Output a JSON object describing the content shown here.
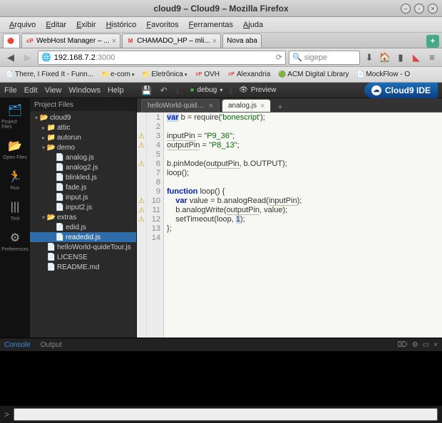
{
  "window": {
    "title": "cloud9 – Cloud9 – Mozilla Firefox"
  },
  "ff_menu": [
    "Arquivo",
    "Editar",
    "Exibir",
    "Histórico",
    "Favoritos",
    "Ferramentas",
    "Ajuda"
  ],
  "ff_tabs": [
    {
      "icon": "🔴",
      "label": "",
      "close": false
    },
    {
      "icon": "cP",
      "label": "WebHost Manager – ...",
      "close": true,
      "iconColor": "#d44"
    },
    {
      "icon": "M",
      "label": "CHAMADO_HP – mli...",
      "close": true,
      "iconColor": "#d33"
    },
    {
      "icon": "",
      "label": "Nova aba",
      "close": false
    }
  ],
  "url": {
    "host": "192.168.7.2",
    "port": ":3000"
  },
  "search": {
    "placeholder": "sigepe"
  },
  "bookmarks": [
    {
      "icon": "📄",
      "label": "There, I Fixed It - Funn..."
    },
    {
      "icon": "📁",
      "label": "e-com",
      "chev": true
    },
    {
      "icon": "📁",
      "label": "Eletrônica",
      "chev": true
    },
    {
      "icon": "cP",
      "label": "OVH",
      "iconColor": "#d44"
    },
    {
      "icon": "cP",
      "label": "Alexandria",
      "iconColor": "#d44"
    },
    {
      "icon": "🟢",
      "label": "ACM Digital Library"
    },
    {
      "icon": "📄",
      "label": "MockFlow - O"
    }
  ],
  "c9_menu": [
    "File",
    "Edit",
    "View",
    "Windows",
    "Help"
  ],
  "c9_chips": {
    "debug": "debug",
    "preview": "Preview"
  },
  "c9_logo": "Cloud9 IDE",
  "rail": [
    {
      "icon": "🗂",
      "label": "Project Files",
      "active": true
    },
    {
      "icon": "📂",
      "label": "Open Files"
    },
    {
      "icon": "🏃",
      "label": "Run"
    },
    {
      "icon": "|||",
      "label": "Test"
    },
    {
      "icon": "⚙",
      "label": "Preferences"
    }
  ],
  "tree_title": "Project Files",
  "tree": [
    {
      "d": 0,
      "t": "folder-open",
      "tw": "▾",
      "name": "cloud9"
    },
    {
      "d": 1,
      "t": "folder-closed",
      "tw": "▸",
      "name": "attic"
    },
    {
      "d": 1,
      "t": "folder-closed",
      "tw": "▸",
      "name": "autorun"
    },
    {
      "d": 1,
      "t": "folder-open",
      "tw": "▾",
      "name": "demo"
    },
    {
      "d": 2,
      "t": "file-js",
      "tw": "",
      "name": "analog.js"
    },
    {
      "d": 2,
      "t": "file-js",
      "tw": "",
      "name": "analog2.js"
    },
    {
      "d": 2,
      "t": "file-js",
      "tw": "",
      "name": "blinkled.js"
    },
    {
      "d": 2,
      "t": "file-js",
      "tw": "",
      "name": "fade.js"
    },
    {
      "d": 2,
      "t": "file-js",
      "tw": "",
      "name": "input.js"
    },
    {
      "d": 2,
      "t": "file-js",
      "tw": "",
      "name": "input2.js"
    },
    {
      "d": 1,
      "t": "folder-open",
      "tw": "▾",
      "name": "extras"
    },
    {
      "d": 2,
      "t": "file-js",
      "tw": "",
      "name": "edid.js"
    },
    {
      "d": 2,
      "t": "file-js",
      "tw": "",
      "name": "readedid.js",
      "selected": true
    },
    {
      "d": 1,
      "t": "file-js",
      "tw": "",
      "name": "helloWorld-quideTour.js"
    },
    {
      "d": 1,
      "t": "file-generic",
      "tw": "",
      "name": "LICENSE"
    },
    {
      "d": 1,
      "t": "file-generic",
      "tw": "",
      "name": "README.md"
    }
  ],
  "editor_tabs": [
    {
      "label": "helloWorld-quide...",
      "active": false
    },
    {
      "label": "analog.js",
      "active": true
    }
  ],
  "code": {
    "warnings": [
      false,
      false,
      true,
      true,
      false,
      true,
      false,
      false,
      false,
      true,
      true,
      true,
      false,
      false
    ],
    "lines_count": 14,
    "l1_a": "var",
    "l1_b": " b = require(",
    "l1_c": "'bonescript'",
    "l1_d": ");",
    "l3_a": "inputPin",
    "l3_b": " = ",
    "l3_c": "\"P9_36\"",
    "l3_d": ";",
    "l4_a": "outputPin",
    "l4_b": " = ",
    "l4_c": "\"P8_13\"",
    "l4_d": ";",
    "l6_a": "b.pinMode(",
    "l6_b": "outputPin",
    "l6_c": ", b.OUTPUT);",
    "l7": "loop();",
    "l9_a": "function",
    "l9_b": " loop() {",
    "l10_a": "    ",
    "l10_b": "var",
    "l10_c": " value = b.analogRead(",
    "l10_d": "inputPin",
    "l10_e": ");",
    "l11_a": "    b.analogWrite(",
    "l11_b": "outputPin",
    "l11_c": ", value);",
    "l12_a": "    setTimeout(loop, ",
    "l12_b": "1",
    "l12_c": ");",
    "l13": "};"
  },
  "bottom_tabs": {
    "console": "Console",
    "output": "Output"
  },
  "repl_prompt": ">"
}
